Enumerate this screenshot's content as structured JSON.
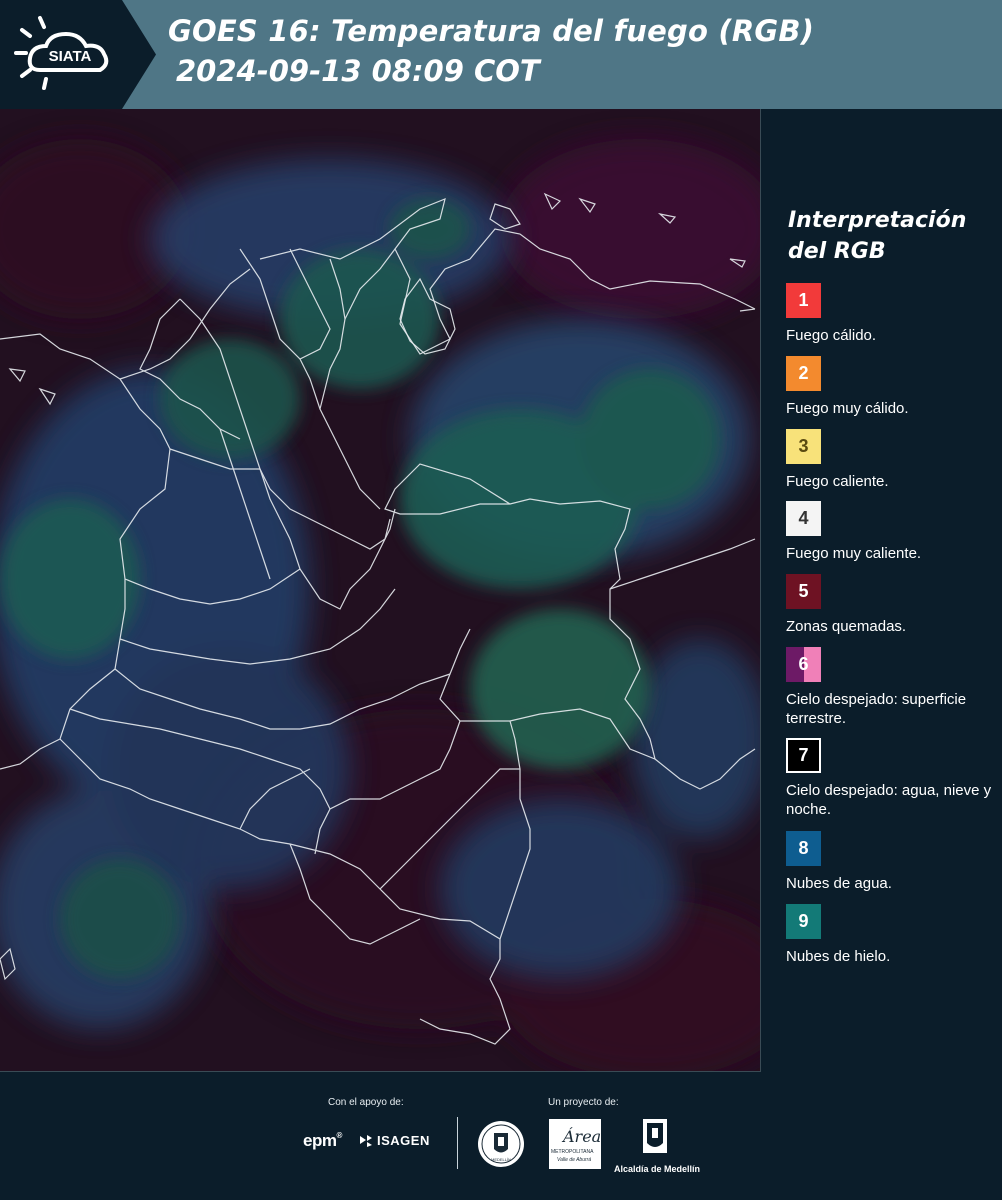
{
  "header": {
    "logo_text": "SIATA",
    "title": "GOES 16: Temperatura del fuego (RGB)",
    "datetime": "2024-09-13 08:09 COT"
  },
  "legend": {
    "title_line1": "Interpretación",
    "title_line2": "del RGB",
    "items": [
      {
        "num": "1",
        "label": "Fuego cálido.",
        "color": "#f23a3a",
        "text_color": "#ffffff"
      },
      {
        "num": "2",
        "label": "Fuego muy cálido.",
        "color": "#f38a2e",
        "text_color": "#ffffff"
      },
      {
        "num": "3",
        "label": "Fuego caliente.",
        "color": "#f8e27a",
        "text_color": "#5a4a10"
      },
      {
        "num": "4",
        "label": "Fuego muy caliente.",
        "color": "#f4f4f4",
        "text_color": "#333333"
      },
      {
        "num": "5",
        "label": "Zonas quemadas.",
        "color": "#6e1223",
        "text_color": "#ffffff"
      },
      {
        "num": "6",
        "label": "Cielo despejado: superficie terrestre.",
        "color": "#6d1a66",
        "text_color": "#ffffff"
      },
      {
        "num": "7",
        "label": "Cielo despejado: agua, nieve y noche.",
        "color": "#000000",
        "text_color": "#ffffff"
      },
      {
        "num": "8",
        "label": "Nubes de agua.",
        "color": "#0e5d90",
        "text_color": "#ffffff"
      },
      {
        "num": "9",
        "label": "Nubes de hielo.",
        "color": "#137a77",
        "text_color": "#ffffff"
      }
    ]
  },
  "footer": {
    "support_label": "Con el apoyo de:",
    "project_label": "Un proyecto de:",
    "sponsor_epm": "epm",
    "sponsor_isagen": "ISAGEN",
    "sponsor_area_line1": "Área",
    "sponsor_area_line2": "METROPOLITANA",
    "sponsor_area_line3": "Valle de Aburrá",
    "sponsor_alcaldia": "Alcaldía de Medellín",
    "sponsor_seal_text": "MEDELLÍN"
  }
}
